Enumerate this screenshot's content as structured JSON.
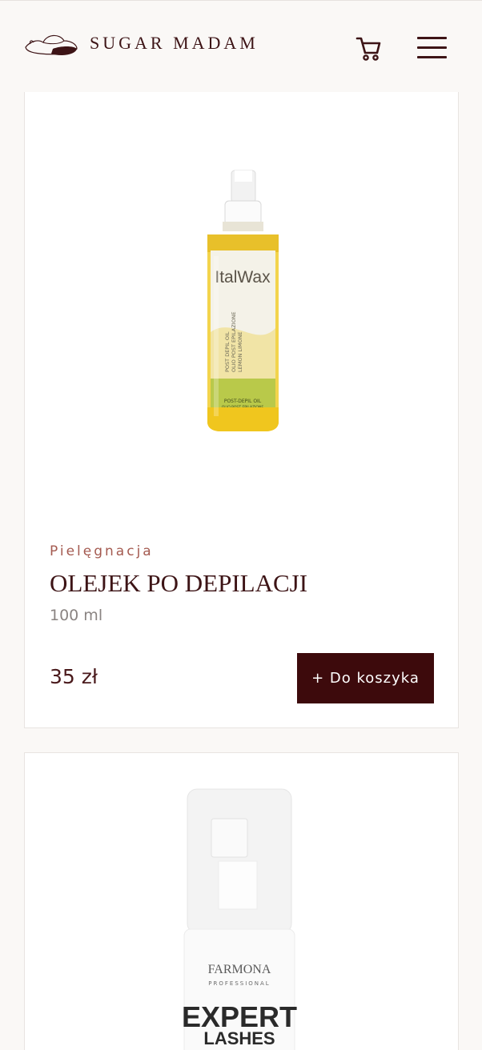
{
  "header": {
    "brand": "SUGAR MADAM",
    "logo_icon": "hat-logo-icon",
    "cart_icon": "cart-icon",
    "menu_icon": "hamburger-menu-icon"
  },
  "products": [
    {
      "category": "Pielęgnacja",
      "title": "OLEJEK PO DEPILACJI",
      "volume": "100 ml",
      "price": "35 zł",
      "add_label": "+ Do koszyka",
      "image": {
        "brand": "ItalWax",
        "label_lines": [
          "POST DEPIL OIL",
          "OLIO POST EPILAZIONE",
          "LEMON LIMONE"
        ],
        "band_lines": [
          "POST-DEPIL OIL",
          "OLIO POST EPILAZIONE"
        ]
      }
    },
    {
      "image": {
        "brand": "FARMONA",
        "sub": "PROFESSIONAL",
        "line1": "EXPERT",
        "line2": "LASHES"
      }
    }
  ],
  "colors": {
    "accent": "#3d0a0c",
    "brand_text": "#3d1416",
    "category": "#a45a50",
    "background": "#faf8f6"
  }
}
